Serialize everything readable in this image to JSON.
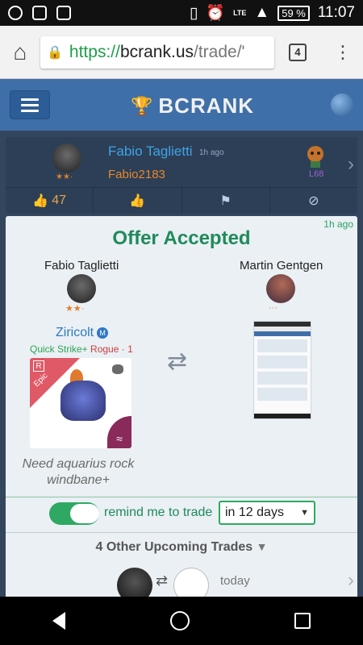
{
  "status": {
    "time": "11:07",
    "battery": "59 %",
    "network": "LTE"
  },
  "browser": {
    "url_scheme": "https://",
    "url_host": "bcrank.us",
    "url_path": "/trade/'",
    "tab_count": "4"
  },
  "app": {
    "logo": "BCRANK"
  },
  "post": {
    "user_display": "Fabio Taglietti",
    "time": "1h ago",
    "username": "Fabio2183",
    "level": "L68",
    "likes": "47"
  },
  "offer": {
    "time": "1h ago",
    "title": "Offer Accepted",
    "left_name": "Fabio Taglietti",
    "right_name": "Martin Gentgen",
    "monster_name": "Ziricolt",
    "monster_badge": "M",
    "skill": "Quick Strike+",
    "rogue": "Rogue · 1",
    "rarity": "Epic",
    "rarity_badge": "R",
    "note": "Need aquarius rock windbane+",
    "remind_label": "remind me to trade",
    "remind_value": "in 12 days",
    "upcoming_label": "4 Other Upcoming Trades",
    "upcoming_when": "today"
  }
}
